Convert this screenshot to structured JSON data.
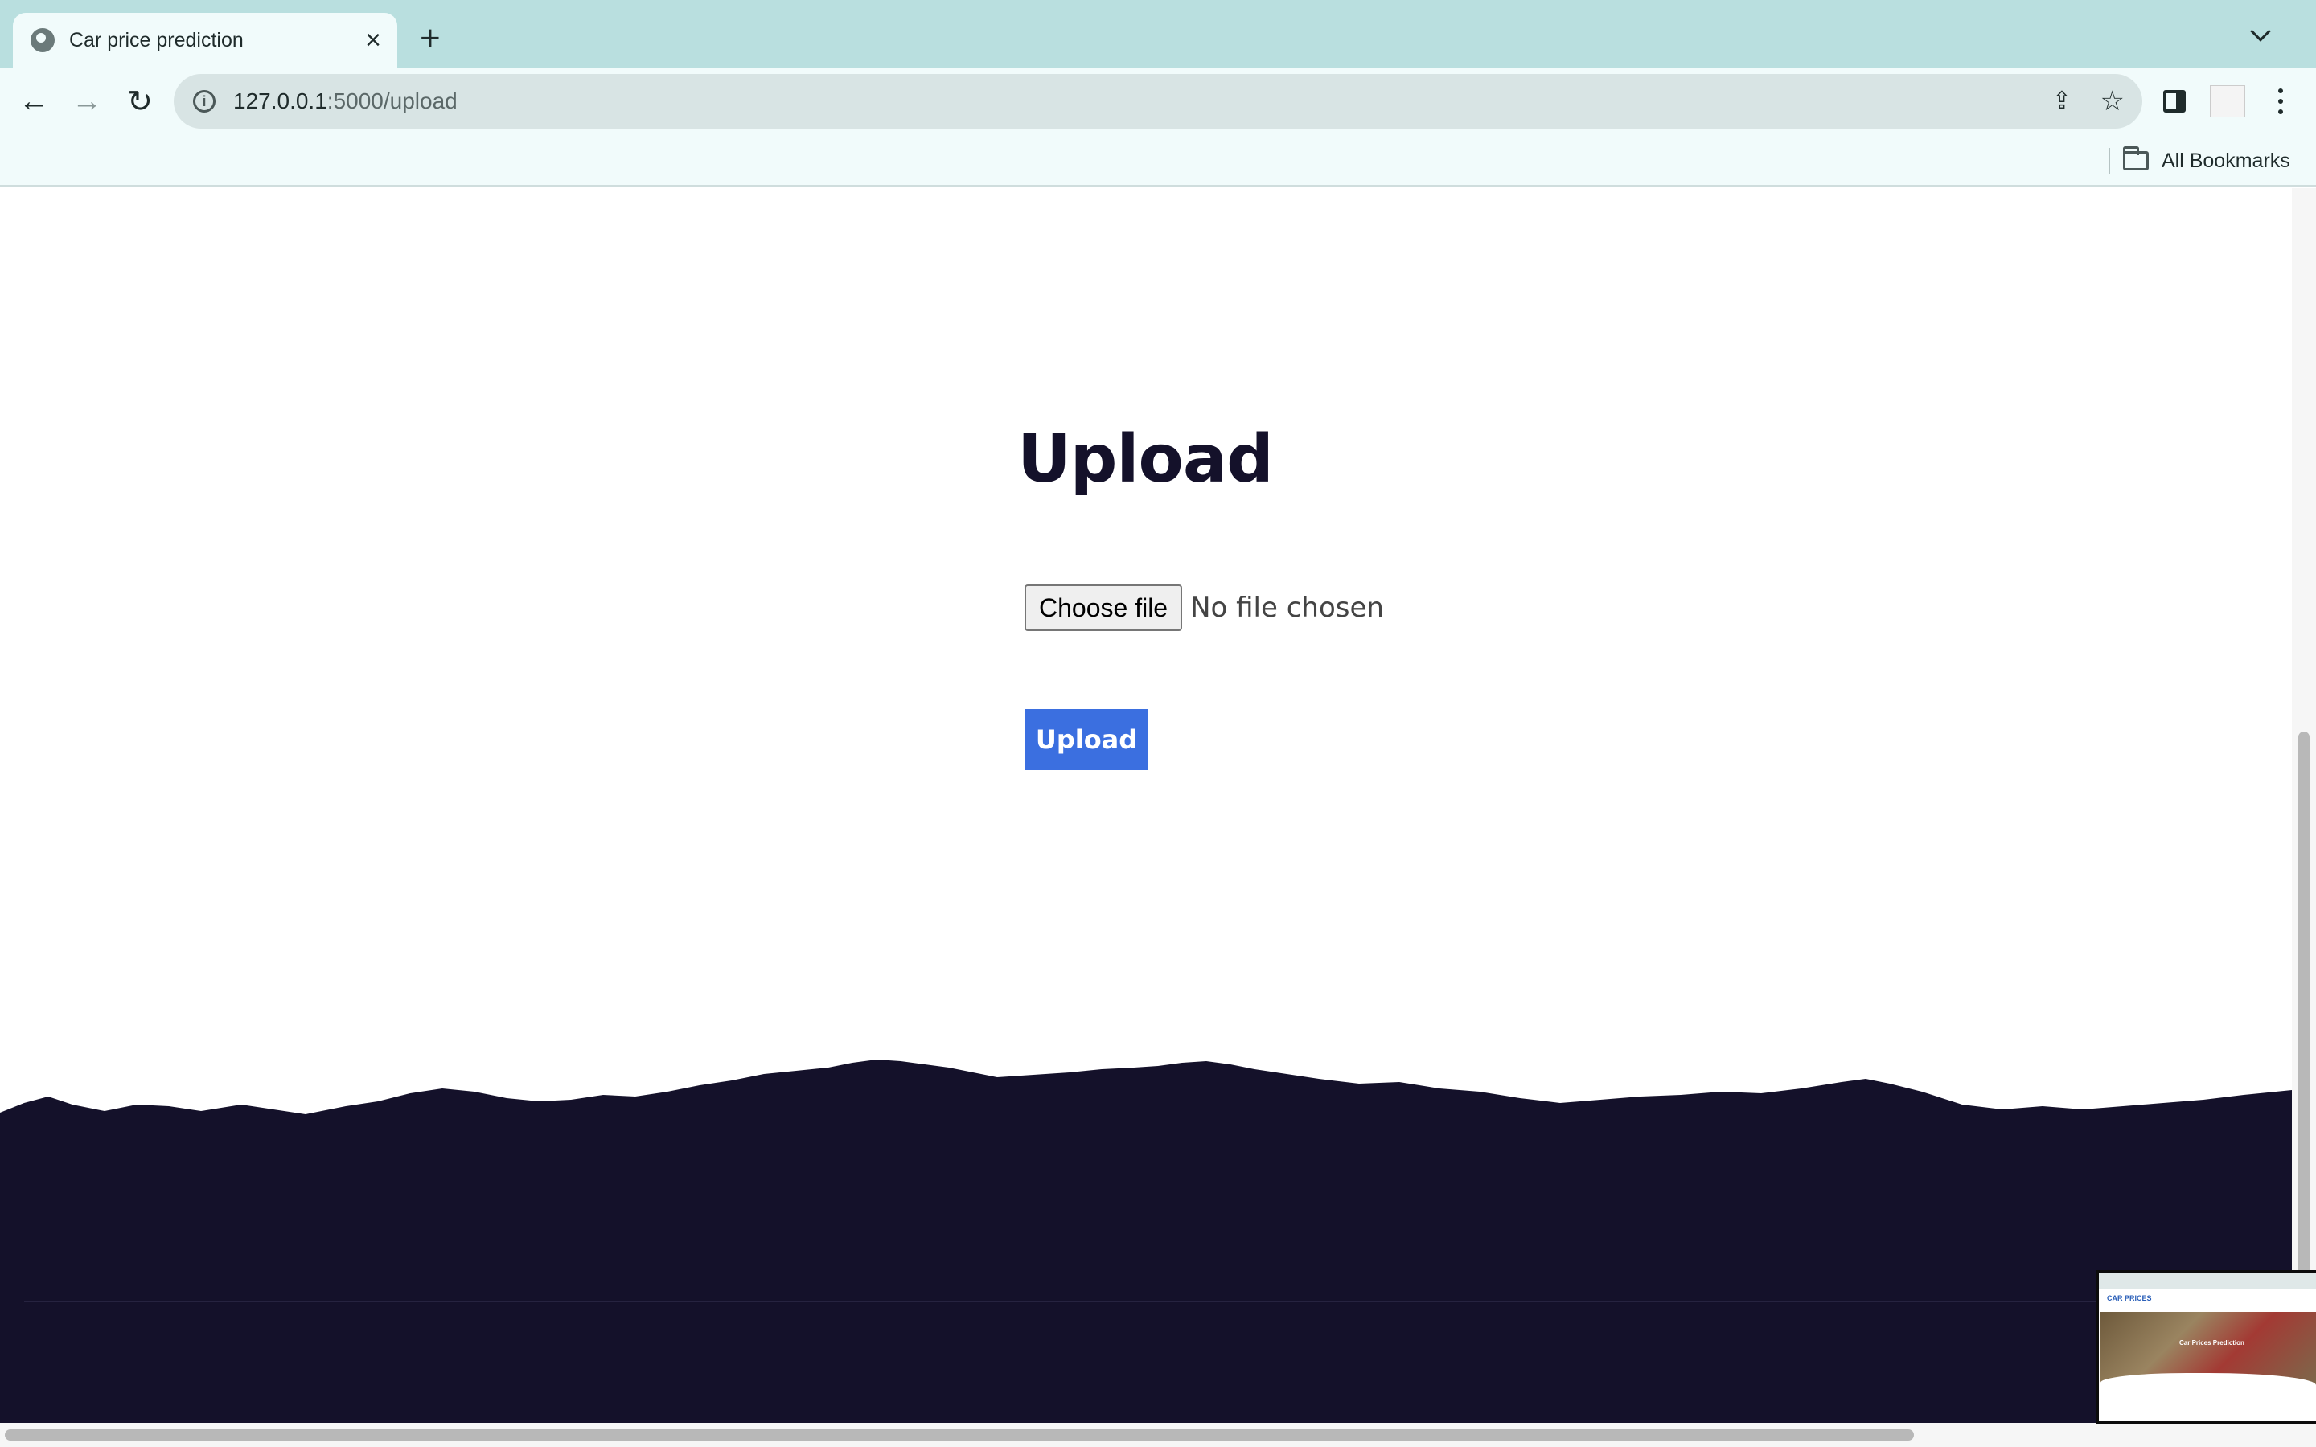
{
  "browser": {
    "tab_title": "Car price prediction",
    "url_host": "127.0.0.1",
    "url_path": ":5000/upload",
    "bookmarks_label": "All Bookmarks"
  },
  "page": {
    "heading": "Upload",
    "file_input": {
      "button_label": "Choose file",
      "status": "No file chosen"
    },
    "submit_label": "Upload"
  },
  "preview_thumbnail": {
    "brand": "CAR PRICES",
    "hero_text": "Car Prices Prediction"
  },
  "colors": {
    "heading": "#14112a",
    "button": "#3b6fe0",
    "footer": "#14112a",
    "chrome": "#b9dfdf"
  },
  "icons": [
    "globe-icon",
    "close-icon",
    "plus-icon",
    "chevron-down-icon",
    "back-arrow-icon",
    "forward-arrow-icon",
    "reload-icon",
    "info-icon",
    "share-icon",
    "star-icon",
    "side-panel-icon",
    "profile-icon",
    "kebab-menu-icon",
    "folder-icon"
  ]
}
